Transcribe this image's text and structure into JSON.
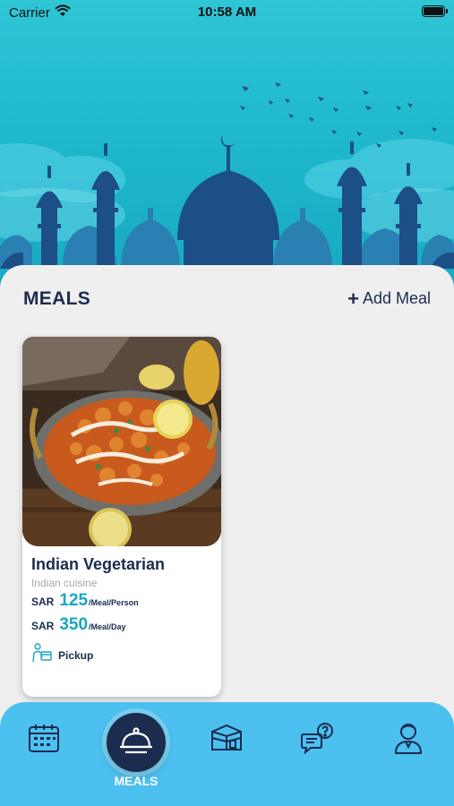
{
  "status_bar": {
    "carrier": "Carrier",
    "time": "10:58 AM"
  },
  "meals_section": {
    "title": "MEALS",
    "add_meal_label": "Add Meal"
  },
  "meals": [
    {
      "name": "Indian Vegetarian",
      "cuisine": "Indian cuisine",
      "prices": [
        {
          "currency": "SAR",
          "amount": "125",
          "unit": "/Meal/Person"
        },
        {
          "currency": "SAR",
          "amount": "350",
          "unit": "/Meal/Day"
        }
      ],
      "delivery": "Pickup"
    }
  ],
  "tab_bar": {
    "active_label": "MEALS",
    "tabs": [
      "calendar-icon",
      "meals-icon",
      "kaaba-icon",
      "chat-question-icon",
      "profile-icon"
    ]
  },
  "colors": {
    "navy": "#1b2c4f",
    "accent": "#1aa6c4",
    "tab_bar": "#4cc0ef",
    "header_sky": "#2fc6d6"
  }
}
